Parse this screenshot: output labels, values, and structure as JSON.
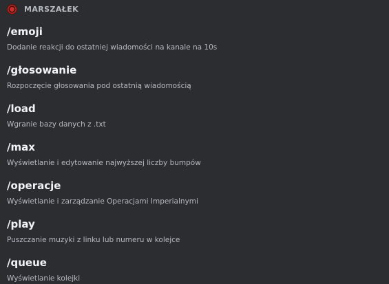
{
  "header": {
    "bot_name": "MARSZAŁEK",
    "avatar_icon": "bot-avatar-icon"
  },
  "commands": [
    {
      "name": "/emoji",
      "description": "Dodanie reakcji do ostatniej wiadomości na kanale na 10s"
    },
    {
      "name": "/głosowanie",
      "description": "Rozpoczęcie głosowania pod ostatnią wiadomością"
    },
    {
      "name": "/load",
      "description": "Wgranie bazy danych z .txt"
    },
    {
      "name": "/max",
      "description": "Wyświetlanie i edytowanie najwyższej liczby bumpów"
    },
    {
      "name": "/operacje",
      "description": "Wyświetlanie i zarządzanie Operacjami Imperialnymi"
    },
    {
      "name": "/play",
      "description": "Puszczanie muzyki z linku lub numeru w kolejce"
    },
    {
      "name": "/queue",
      "description": "Wyświetlanie kolejki"
    }
  ]
}
